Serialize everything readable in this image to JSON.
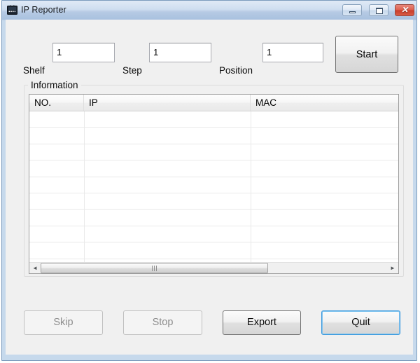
{
  "window": {
    "title": "IP Reporter",
    "icon": "app-icon",
    "controls": {
      "minimize_label": "Minimize",
      "maximize_label": "Maximize",
      "close_glyph": "✕",
      "close_label": "Close"
    }
  },
  "form": {
    "fields": [
      {
        "key": "shelf",
        "label": "Shelf",
        "value": "1",
        "placeholder": ""
      },
      {
        "key": "step",
        "label": "Step",
        "value": "1",
        "placeholder": ""
      },
      {
        "key": "position",
        "label": "Position",
        "value": "1",
        "placeholder": ""
      }
    ],
    "start_button": "Start"
  },
  "information": {
    "legend": "Information",
    "columns": [
      {
        "key": "no",
        "label": "NO."
      },
      {
        "key": "ip",
        "label": "IP"
      },
      {
        "key": "mac",
        "label": "MAC"
      }
    ],
    "rows": [],
    "empty_row_count": 10,
    "scrollbar": {
      "left_arrow": "◄",
      "right_arrow": "►",
      "orientation": "horizontal"
    }
  },
  "actions": [
    {
      "key": "skip",
      "label": "Skip",
      "state": "disabled"
    },
    {
      "key": "stop",
      "label": "Stop",
      "state": "disabled"
    },
    {
      "key": "export",
      "label": "Export",
      "state": "enabled"
    },
    {
      "key": "quit",
      "label": "Quit",
      "state": "default"
    }
  ],
  "colors": {
    "title_bar_top": "#e0eaf6",
    "title_bar_bottom": "#a8c1df",
    "window_frame": "#c6d9ec",
    "client_background": "#f0f0f0",
    "close_button": "#c83d2a",
    "default_button_focus": "#3c9ade",
    "disabled_text": "#8d8d8d"
  }
}
